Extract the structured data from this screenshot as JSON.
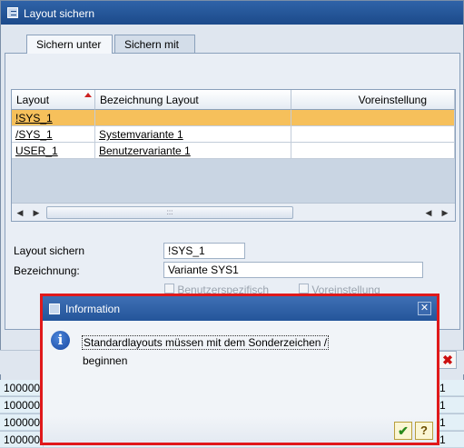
{
  "main_window": {
    "title": "Layout sichern",
    "tabs": [
      {
        "label": "Sichern unter"
      },
      {
        "label": "Sichern mit"
      }
    ],
    "grid": {
      "columns": [
        "Layout",
        "Bezeichnung Layout",
        "Voreinstellung"
      ],
      "rows": [
        {
          "layout": "!SYS_1",
          "bezeichnung": "",
          "voreinstellung": ""
        },
        {
          "layout": "/SYS_1",
          "bezeichnung": "Systemvariante 1",
          "voreinstellung": ""
        },
        {
          "layout": "USER_1",
          "bezeichnung": "Benutzervariante 1",
          "voreinstellung": ""
        }
      ],
      "scroll_grip": ":::"
    },
    "form": {
      "layout_label": "Layout sichern",
      "layout_value": "!SYS_1",
      "bezeichnung_label": "Bezeichnung:",
      "bezeichnung_value": "Variante SYS1",
      "checkbox_user": "Benutzerspezifisch",
      "checkbox_default": "Voreinstellung"
    }
  },
  "background_rows": [
    {
      "c1": "100000",
      "c2": "1"
    },
    {
      "c1": "100000",
      "c2": "1"
    },
    {
      "c1": "100000",
      "c2": "1"
    },
    {
      "c1": "100000",
      "c2": "1"
    }
  ],
  "dialog": {
    "title": "Information",
    "icon": "i",
    "message_line1": "Standardlayouts müssen mit dem Sonderzeichen /",
    "message_line2": "beginnen",
    "close_glyph": "✕",
    "ok_glyph": "✔",
    "help_glyph": "?"
  },
  "colors": {
    "title_bar": "#1c4a8a",
    "selected_row": "#f6c05b",
    "dialog_highlight": "#e0191b"
  }
}
